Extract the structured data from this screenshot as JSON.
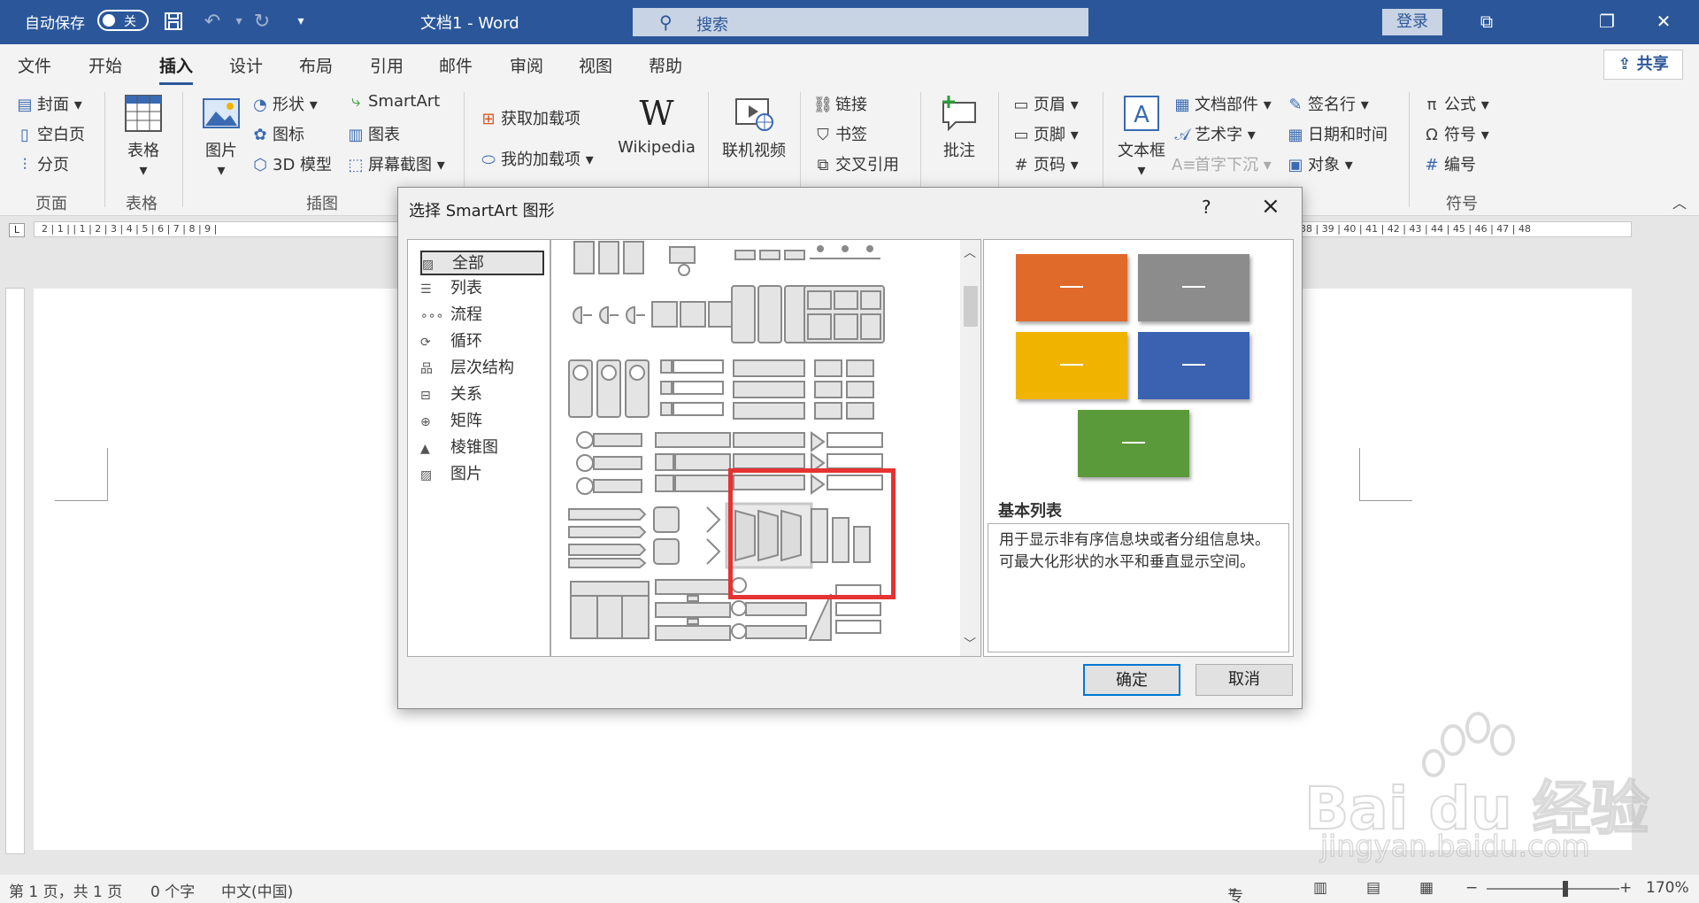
{
  "titlebar": {
    "autosave_label": "自动保存",
    "autosave_state": "关",
    "doc_title": "文档1 - Word",
    "search_placeholder": "搜索",
    "login": "登录"
  },
  "tabs": [
    "文件",
    "开始",
    "插入",
    "设计",
    "布局",
    "引用",
    "邮件",
    "审阅",
    "视图",
    "帮助"
  ],
  "active_tab": "插入",
  "share_label": "共享",
  "ribbon": {
    "pages_group": {
      "items": [
        "封面",
        "空白页",
        "分页"
      ],
      "label": "页面"
    },
    "table_group": {
      "button": "表格",
      "label": "表格"
    },
    "illustrations_group": {
      "picture": "图片",
      "items_col1": [
        "形状",
        "图标",
        "3D 模型"
      ],
      "items_col2": [
        "SmartArt",
        "图表",
        "屏幕截图"
      ],
      "label": "插图"
    },
    "addins_group": {
      "get_addins": "获取加载项",
      "my_addins": "我的加载项",
      "wikipedia": "Wikipedia"
    },
    "media_group": {
      "online_video": "联机视频"
    },
    "links_group": {
      "items": [
        "链接",
        "书签",
        "交叉引用"
      ]
    },
    "comments_group": {
      "comment": "批注"
    },
    "header_group": {
      "items": [
        "页眉",
        "页脚",
        "页码"
      ]
    },
    "text_group": {
      "textbox": "文本框",
      "items_col1": [
        "文档部件",
        "艺术字",
        "首字下沉"
      ],
      "items_col2": [
        "签名行",
        "日期和时间",
        "对象"
      ]
    },
    "symbols_group": {
      "items": [
        "公式",
        "符号",
        "编号"
      ],
      "label": "符号"
    }
  },
  "ruler_text": "2 | 1 | | 1 | 2 | 3 | 4 | 5 | 6 | 7 | 8 | 9 |",
  "ruler_text_right": "38 | 39 | 40 | 41 | 42 | 43 | 44 | 45 | 46 | 47 | 48",
  "status": {
    "page": "第 1 页，共 1 页",
    "words": "0 个字",
    "lang": "中文(中国)",
    "focus": "专注",
    "zoom": "170%"
  },
  "dialog": {
    "title": "选择 SmartArt 图形",
    "help": "?",
    "categories": [
      "全部",
      "列表",
      "流程",
      "循环",
      "层次结构",
      "关系",
      "矩阵",
      "棱锥图",
      "图片"
    ],
    "selected_category": "全部",
    "preview_name": "基本列表",
    "preview_desc": "用于显示非有序信息块或者分组信息块。可最大化形状的水平和垂直显示空间。",
    "preview_colors": [
      "#e06a2a",
      "#8c8c8c",
      "#f0b400",
      "#3a62b0",
      "#5a9a3a"
    ],
    "ok": "确定",
    "cancel": "取消"
  },
  "watermark": {
    "brand": "Bai  du 经验",
    "url": "jingyan.baidu.com"
  }
}
